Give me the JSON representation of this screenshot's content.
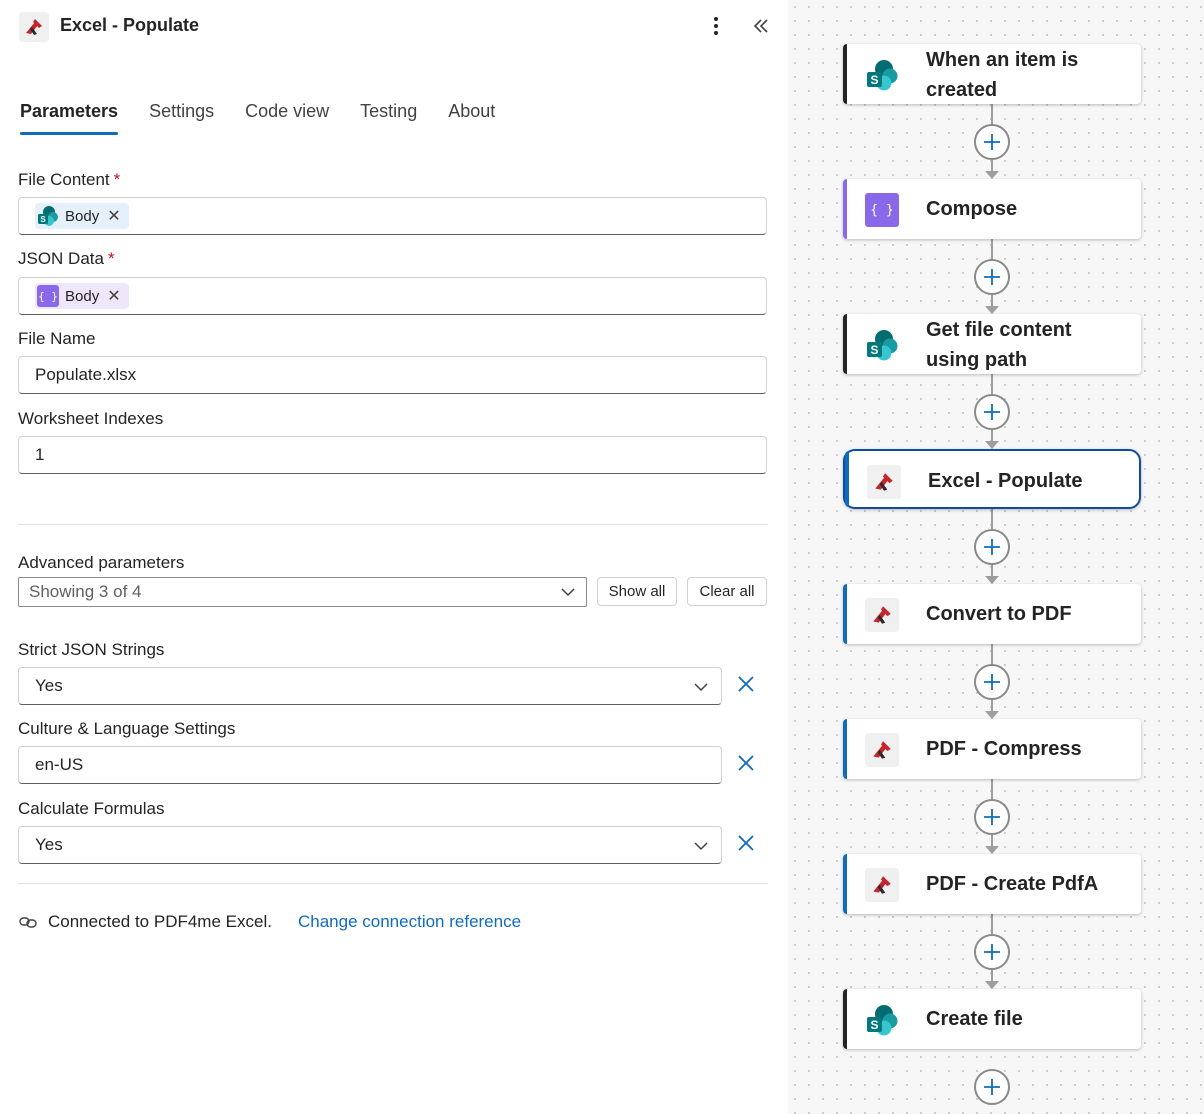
{
  "header": {
    "title": "Excel - Populate"
  },
  "tabs": [
    {
      "label": "Parameters",
      "active": true
    },
    {
      "label": "Settings"
    },
    {
      "label": "Code view"
    },
    {
      "label": "Testing"
    },
    {
      "label": "About"
    }
  ],
  "fields": {
    "file_content": {
      "label": "File Content",
      "required": "*",
      "token": "Body",
      "token_source": "sharepoint-icon"
    },
    "json_data": {
      "label": "JSON Data",
      "required": "*",
      "token": "Body",
      "token_source": "compose-icon"
    },
    "file_name": {
      "label": "File Name",
      "value": "Populate.xlsx"
    },
    "worksheet_indexes": {
      "label": "Worksheet Indexes",
      "value": "1"
    }
  },
  "advanced": {
    "label": "Advanced parameters",
    "showing": "Showing 3 of 4",
    "show_all": "Show all",
    "clear_all": "Clear all",
    "strict_json": {
      "label": "Strict JSON Strings",
      "value": "Yes"
    },
    "culture": {
      "label": "Culture & Language Settings",
      "value": "en-US"
    },
    "calculate": {
      "label": "Calculate Formulas",
      "value": "Yes"
    }
  },
  "connection": {
    "text": "Connected to PDF4me Excel.",
    "link": "Change connection reference"
  },
  "flow": {
    "steps": [
      {
        "line1": "When an item is",
        "line2": "created",
        "icon": "sharepoint-icon"
      },
      {
        "line1": "Compose",
        "icon": "compose-icon"
      },
      {
        "line1": "Get file content",
        "line2": "using path",
        "icon": "sharepoint-icon"
      },
      {
        "line1": "Excel - Populate",
        "icon": "pdf4me-icon",
        "selected": true
      },
      {
        "line1": "Convert to PDF",
        "icon": "pdf4me-icon"
      },
      {
        "line1": "PDF - Compress",
        "icon": "pdf4me-icon"
      },
      {
        "line1": "PDF - Create PdfA",
        "icon": "pdf4me-icon"
      },
      {
        "line1": "Create file",
        "icon": "sharepoint-icon"
      }
    ]
  },
  "colors": {
    "accent": "#0f6cbd",
    "compose": "#8a68ea",
    "sharepoint": "#038387",
    "pdf4me_red": "#c4262e"
  }
}
